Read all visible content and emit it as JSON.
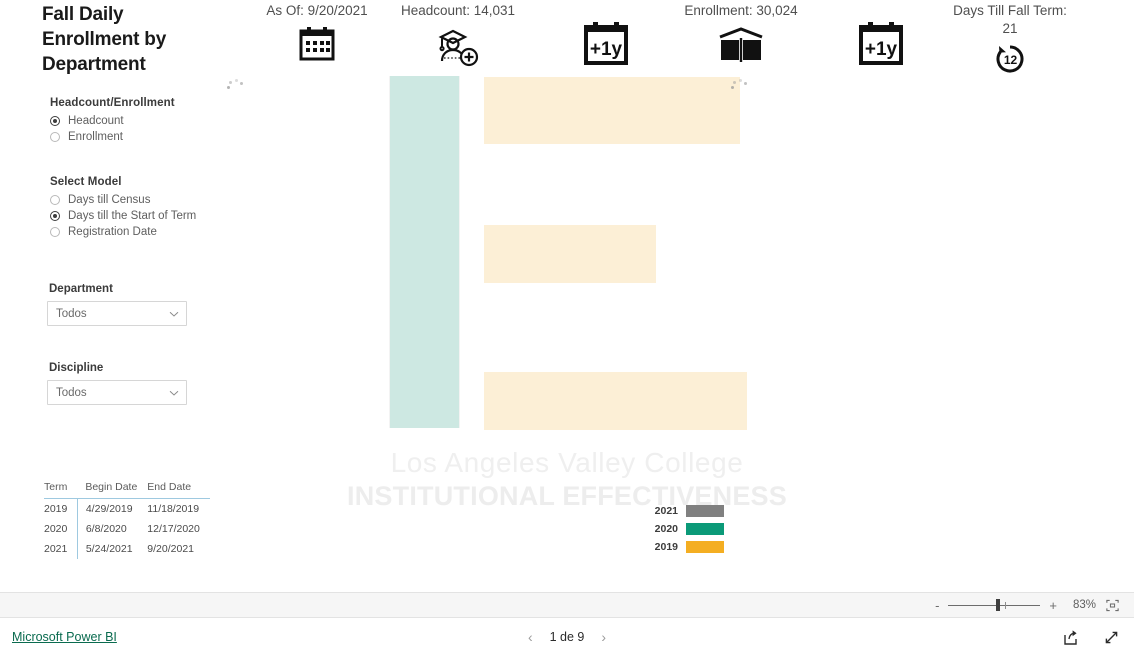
{
  "report": {
    "title": "Fall Daily Enrollment by Department",
    "watermark_line1": "Los Angeles Valley College",
    "watermark_line2": "INSTITUTIONAL EFFECTIVENESS"
  },
  "slicers": {
    "headcount_enrollment": {
      "heading": "Headcount/Enrollment",
      "options": [
        {
          "label": "Headcount",
          "selected": true
        },
        {
          "label": "Enrollment",
          "selected": false
        }
      ]
    },
    "select_model": {
      "heading": "Select Model",
      "options": [
        {
          "label": "Days till Census",
          "selected": false
        },
        {
          "label": "Days till the Start of Term",
          "selected": true
        },
        {
          "label": "Registration Date",
          "selected": false
        }
      ]
    },
    "department": {
      "label": "Department",
      "value": "Todos",
      "icon": "chevron-down-icon"
    },
    "discipline": {
      "label": "Discipline",
      "value": "Todos",
      "icon": "chevron-down-icon"
    }
  },
  "term_table": {
    "columns": [
      "Term",
      "Begin Date",
      "End Date"
    ],
    "rows": [
      [
        "2019",
        "4/29/2019",
        "11/18/2019"
      ],
      [
        "2020",
        "6/8/2020",
        "12/17/2020"
      ],
      [
        "2021",
        "5/24/2021",
        "9/20/2021"
      ]
    ]
  },
  "kpis": [
    {
      "text": "As Of: 9/20/2021",
      "icon": "calendar-icon"
    },
    {
      "text": "Headcount: 14,031",
      "icon": "graduate-add-icon"
    },
    {
      "text": "Enrollment: 30,024",
      "icon": "calendar-plus-1y-icon"
    },
    {
      "text": "Days Till Fall Term:\n21",
      "icon": "clock-12-icon"
    }
  ],
  "kpi_extra_icons": [
    {
      "icon": "calendar-plus-1y-icon"
    }
  ],
  "legend": {
    "items": [
      {
        "label": "2021",
        "color": "#808080"
      },
      {
        "label": "2020",
        "color": "#0b9a78"
      },
      {
        "label": "2019",
        "color": "#f4ae22"
      }
    ]
  },
  "loading": {
    "skeleton_mint_color": "#cde8e2",
    "skeleton_cream_color": "#fcefd6",
    "spinner_name": "loading-spinner"
  },
  "chart_data": {
    "type": "bar",
    "title": "Fall Daily Enrollment by Department",
    "state": "loading",
    "categories": [
      "2021",
      "2020",
      "2019"
    ],
    "series": [
      {
        "name": "2021",
        "color": "#808080",
        "values": []
      },
      {
        "name": "2020",
        "color": "#0b9a78",
        "values": []
      },
      {
        "name": "2019",
        "color": "#f4ae22",
        "values": []
      }
    ],
    "xlabel": "",
    "ylabel": "",
    "legend_position": "bottom-right",
    "grid": false,
    "note": "Visuals not yet rendered - placeholder skeleton blocks shown"
  },
  "zoom_bar": {
    "minus": "-",
    "plus": "+",
    "percent": "83%",
    "fit_icon": "fit-to-page-icon"
  },
  "status_bar": {
    "brand": "Microsoft Power BI",
    "prev_icon": "chevron-left-icon",
    "next_icon": "chevron-right-icon",
    "page_label": "1 de 9",
    "share_icon": "share-icon",
    "fullscreen_icon": "fullscreen-icon"
  }
}
